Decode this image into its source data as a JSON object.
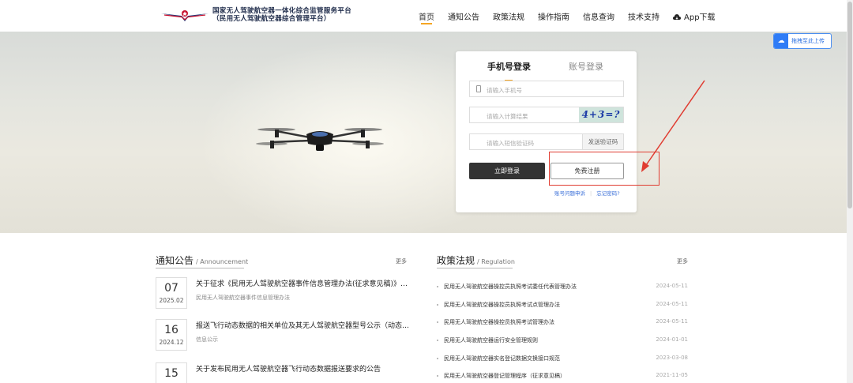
{
  "header": {
    "title_line1": "国家无人驾驶航空器一体化综合监管服务平台",
    "title_line2": "（民用无人驾驶航空器综合管理平台）",
    "nav": [
      "首页",
      "通知公告",
      "政策法规",
      "操作指南",
      "信息查询",
      "技术支持"
    ],
    "app_download": "App下载"
  },
  "baidu_upload": "拖拽至此上传",
  "login": {
    "tab_phone": "手机号登录",
    "tab_account": "账号登录",
    "phone_placeholder": "请输入手机号",
    "captcha_placeholder": "请输入计算结果",
    "captcha_text": "4+3=?",
    "sms_placeholder": "请输入短信验证码",
    "sms_button": "发送验证码",
    "login_button": "立即登录",
    "register_button": "免费注册",
    "link_appeal": "账号问题申诉",
    "link_forgot": "忘记密码?"
  },
  "annotation_color": "#e03c31",
  "notices": {
    "title": "通知公告",
    "title_en": "/ Announcement",
    "more": "更多",
    "items": [
      {
        "day": "07",
        "ym": "2025.02",
        "title": "关于征求《民用无人驾驶航空器事件信息管理办法(征求意见稿)》意见的通知",
        "sub": "民用无人驾驶航空器事件信息管理办法"
      },
      {
        "day": "16",
        "ym": "2024.12",
        "title": "报送飞行动态数据的相关单位及其无人驾驶航空器型号公示（动态更新）",
        "sub": "信息公示"
      },
      {
        "day": "15",
        "ym": "",
        "title": "关于发布民用无人驾驶航空器飞行动态数据报送要求的公告",
        "sub": ""
      }
    ]
  },
  "policies": {
    "title": "政策法规",
    "title_en": "/ Regulation",
    "more": "更多",
    "items": [
      {
        "title": "民用无人驾驶航空器操控员执照考试委任代表管理办法",
        "date": "2024-05-11"
      },
      {
        "title": "民用无人驾驶航空器操控员执照考试点管理办法",
        "date": "2024-05-11"
      },
      {
        "title": "民用无人驾驶航空器操控员执照考试管理办法",
        "date": "2024-05-11"
      },
      {
        "title": "民用无人驾驶航空器运行安全管理规则",
        "date": "2024-01-01"
      },
      {
        "title": "民用无人驾驶航空器实名登记数据交换接口规范",
        "date": "2023-03-08"
      },
      {
        "title": "民用无人驾驶航空器登记管理程序（征求意见稿）",
        "date": "2021-11-05"
      }
    ]
  }
}
